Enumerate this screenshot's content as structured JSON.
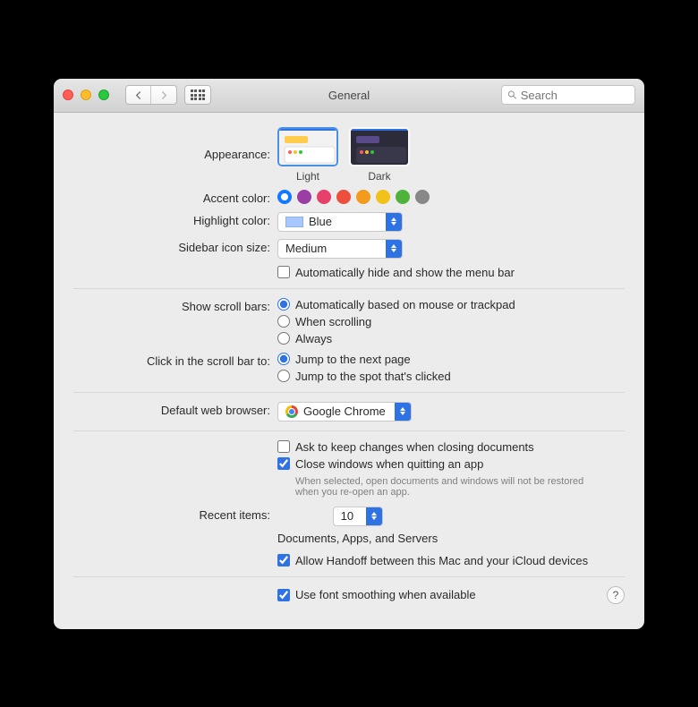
{
  "window": {
    "title": "General"
  },
  "search": {
    "placeholder": "Search"
  },
  "colors": {
    "accent_options": [
      "#1079ff",
      "#9a3ea4",
      "#e5416b",
      "#ec4f3c",
      "#f29b1d",
      "#f2c21a",
      "#4fb33b",
      "#888888"
    ],
    "accent_selected": 0
  },
  "appearance": {
    "label": "Appearance:",
    "options": [
      {
        "label": "Light",
        "selected": true
      },
      {
        "label": "Dark",
        "selected": false
      }
    ]
  },
  "accent": {
    "label": "Accent color:"
  },
  "highlight": {
    "label": "Highlight color:",
    "value": "Blue"
  },
  "sidebar_size": {
    "label": "Sidebar icon size:",
    "value": "Medium"
  },
  "menubar_hide": {
    "label": "Automatically hide and show the menu bar",
    "checked": false
  },
  "scrollbars": {
    "label": "Show scroll bars:",
    "options": [
      "Automatically based on mouse or trackpad",
      "When scrolling",
      "Always"
    ],
    "selected": 0
  },
  "click_scrollbar": {
    "label": "Click in the scroll bar to:",
    "options": [
      "Jump to the next page",
      "Jump to the spot that's clicked"
    ],
    "selected": 0
  },
  "default_browser": {
    "label": "Default web browser:",
    "value": "Google Chrome"
  },
  "ask_changes": {
    "label": "Ask to keep changes when closing documents",
    "checked": false
  },
  "close_windows": {
    "label": "Close windows when quitting an app",
    "checked": true,
    "hint": "When selected, open documents and windows will not be restored when you re-open an app."
  },
  "recent_items": {
    "label": "Recent items:",
    "value": "10",
    "suffix": "Documents, Apps, and Servers"
  },
  "handoff": {
    "label": "Allow Handoff between this Mac and your iCloud devices",
    "checked": true
  },
  "font_smoothing": {
    "label": "Use font smoothing when available",
    "checked": true
  }
}
